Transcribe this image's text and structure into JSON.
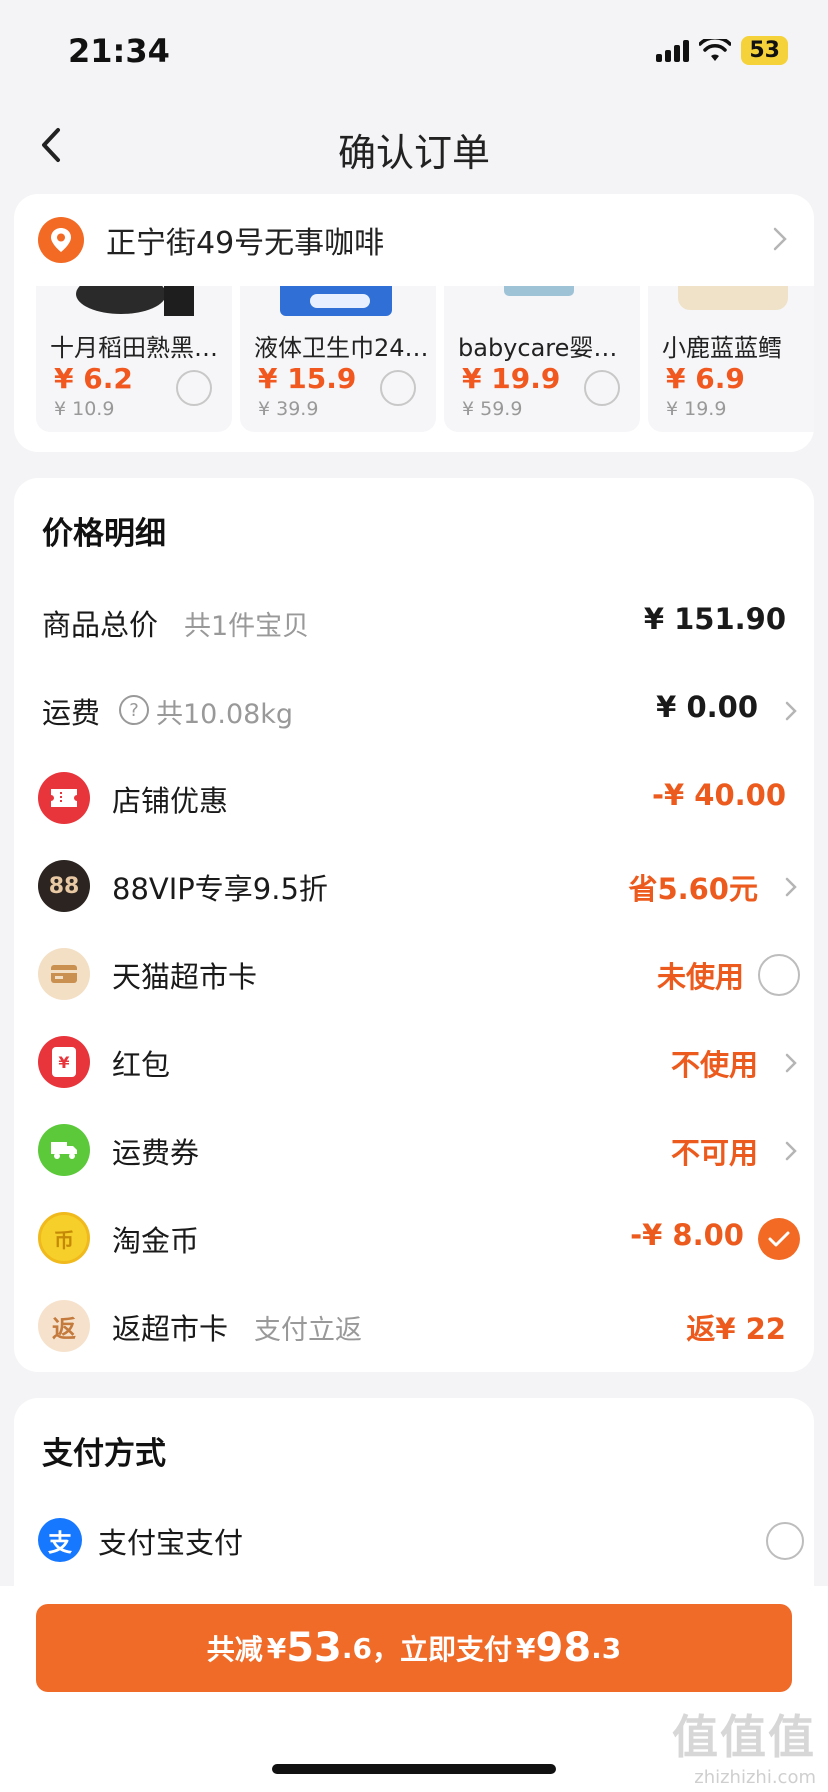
{
  "status_bar": {
    "time": "21:34",
    "battery": "53"
  },
  "nav": {
    "title": "确认订单"
  },
  "address": {
    "text": "正宁街49号无事咖啡"
  },
  "products": [
    {
      "name": "十月稻田熟黑…",
      "price": "¥ 6.2",
      "old_price": "¥ 10.9"
    },
    {
      "name": "液体卫生巾24…",
      "price": "¥ 15.9",
      "old_price": "¥ 39.9"
    },
    {
      "name": "babycare婴…",
      "price": "¥ 19.9",
      "old_price": "¥ 59.9"
    },
    {
      "name": "小鹿蓝蓝鳕",
      "price": "¥ 6.9",
      "old_price": "¥ 19.9"
    }
  ],
  "price_detail": {
    "title": "价格明细",
    "goods_total": {
      "label": "商品总价",
      "sub": "共1件宝贝",
      "value": "¥ 151.90"
    },
    "shipping": {
      "label": "运费",
      "sub": "共10.08kg",
      "value": "¥ 0.00"
    },
    "shop_discount": {
      "label": "店铺优惠",
      "value": "-¥ 40.00"
    },
    "vip": {
      "icon_text": "88",
      "label": "88VIP专享9.5折",
      "value": "省5.60元"
    },
    "tmall_card": {
      "label": "天猫超市卡",
      "value": "未使用"
    },
    "red_packet": {
      "label": "红包",
      "value": "不使用",
      "icon_text": "¥"
    },
    "shipping_coupon": {
      "label": "运费券",
      "value": "不可用"
    },
    "taojin": {
      "label": "淘金币",
      "value": "-¥ 8.00",
      "icon_text": "币"
    },
    "return_card": {
      "icon_text": "返",
      "label": "返超市卡",
      "sub": "支付立返",
      "value": "返¥ 22"
    }
  },
  "payment": {
    "title": "支付方式",
    "alipay": {
      "icon_text": "支",
      "label": "支付宝支付"
    }
  },
  "pay_button": {
    "prefix": "共减",
    "yen1": "¥",
    "discount": "53",
    "discount_dec": ".6",
    "mid": "，立即支付",
    "yen2": "¥",
    "total": "98",
    "total_dec": ".3"
  },
  "watermark": {
    "big": "值值值",
    "url": "zhizhizhi.com"
  },
  "colors": {
    "accent": "#f06a28",
    "price_orange": "#ec5b1d",
    "alipay_blue": "#1677ff"
  }
}
